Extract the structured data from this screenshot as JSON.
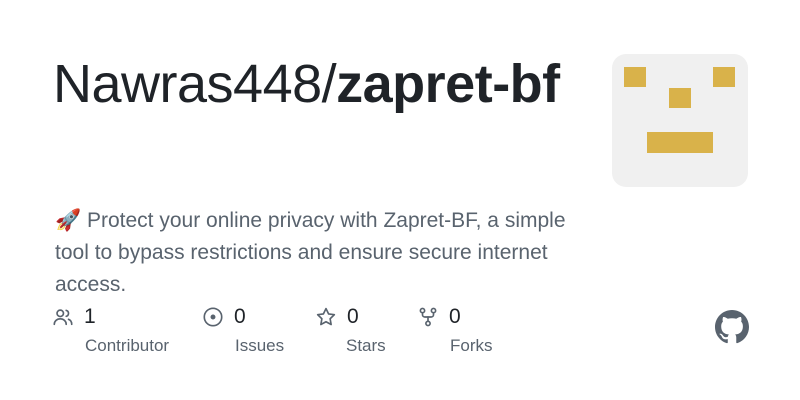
{
  "repo": {
    "owner": "Nawras448/",
    "name": "zapret-bf",
    "description": "🚀 Protect your online privacy with Zapret-BF, a simple tool to bypass restrictions and ensure secure internet access."
  },
  "stats": [
    {
      "icon": "people-icon",
      "value": "1",
      "label": "Contributor"
    },
    {
      "icon": "issue-icon",
      "value": "0",
      "label": "Issues"
    },
    {
      "icon": "star-icon",
      "value": "0",
      "label": "Stars"
    },
    {
      "icon": "fork-icon",
      "value": "0",
      "label": "Forks"
    }
  ],
  "colors": {
    "avatar_bg": "#f0f0f0",
    "avatar_blocks": "#d9b24a",
    "muted_text": "#59636e",
    "main_text": "#1f2328"
  },
  "brand_icon": "github-mark-icon"
}
